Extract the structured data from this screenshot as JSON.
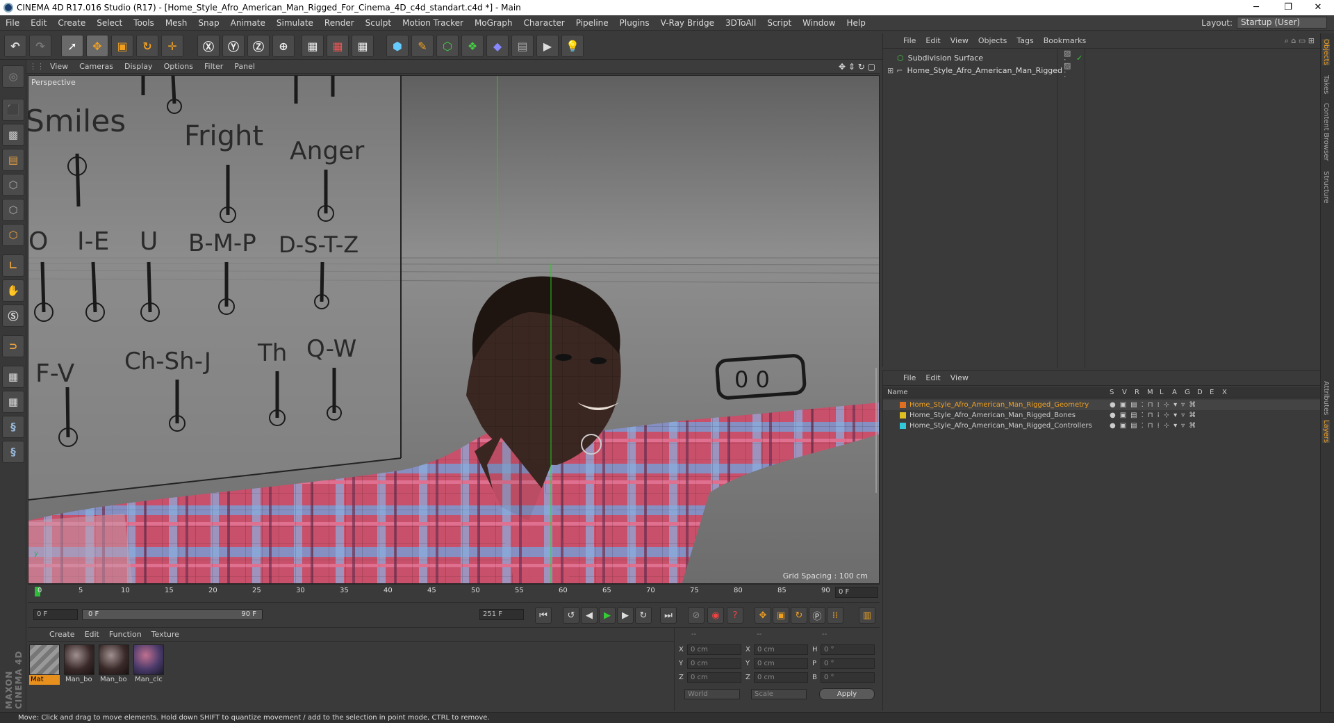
{
  "window": {
    "title": "CINEMA 4D R17.016 Studio (R17) - [Home_Style_Afro_American_Man_Rigged_For_Cinema_4D_c4d_standart.c4d *] - Main",
    "minimize": "─",
    "maximize": "❐",
    "close": "✕"
  },
  "menubar": {
    "items": [
      "File",
      "Edit",
      "Create",
      "Select",
      "Tools",
      "Mesh",
      "Snap",
      "Animate",
      "Simulate",
      "Render",
      "Sculpt",
      "Motion Tracker",
      "MoGraph",
      "Character",
      "Pipeline",
      "Plugins",
      "V-Ray Bridge",
      "3DToAll",
      "Script",
      "Window",
      "Help"
    ],
    "layout_label": "Layout:",
    "layout_value": "Startup (User)"
  },
  "viewport": {
    "menu": [
      "View",
      "Cameras",
      "Display",
      "Options",
      "Filter",
      "Panel"
    ],
    "label": "Perspective",
    "grid_spacing": "Grid Spacing : 100 cm",
    "board_labels": [
      "Smiles",
      "Fright",
      "Anger",
      "O",
      "I-E",
      "U",
      "B-M-P",
      "D-S-T-Z",
      "F-V",
      "Ch-Sh-J",
      "Th",
      "Q-W"
    ],
    "eye_control": "0    0"
  },
  "timeline": {
    "ticks": [
      "0",
      "5",
      "10",
      "15",
      "20",
      "25",
      "30",
      "35",
      "40",
      "45",
      "50",
      "55",
      "60",
      "65",
      "70",
      "75",
      "80",
      "85",
      "90"
    ],
    "current": "0 F"
  },
  "transport": {
    "start": "0 F",
    "range_start": "0 F",
    "range_end": "90 F",
    "end": "251 F"
  },
  "materials": {
    "menu": [
      "Create",
      "Edit",
      "Function",
      "Texture"
    ],
    "items": [
      "Mat",
      "Man_bo",
      "Man_bo",
      "Man_clc"
    ]
  },
  "coords": {
    "headers": [
      "--",
      "--",
      "--"
    ],
    "rows": [
      {
        "a": "X",
        "av": "0 cm",
        "b": "X",
        "bv": "0 cm",
        "c": "H",
        "cv": "0 °"
      },
      {
        "a": "Y",
        "av": "0 cm",
        "b": "Y",
        "bv": "0 cm",
        "c": "P",
        "cv": "0 °"
      },
      {
        "a": "Z",
        "av": "0 cm",
        "b": "Z",
        "bv": "0 cm",
        "c": "B",
        "cv": "0 °"
      }
    ],
    "world": "World",
    "scale": "Scale",
    "apply": "Apply"
  },
  "objects": {
    "menu": [
      "File",
      "Edit",
      "View",
      "Objects",
      "Tags",
      "Bookmarks"
    ],
    "items": [
      "Subdivision Surface",
      "Home_Style_Afro_American_Man_Rigged"
    ]
  },
  "layers": {
    "menu": [
      "File",
      "Edit",
      "View"
    ],
    "header": "Name",
    "cols": [
      "S",
      "V",
      "R",
      "M",
      "L",
      "A",
      "G",
      "D",
      "E",
      "X"
    ],
    "items": [
      {
        "name": "Home_Style_Afro_American_Man_Rigged_Geometry",
        "color": "#e07020"
      },
      {
        "name": "Home_Style_Afro_American_Man_Rigged_Bones",
        "color": "#e0c020"
      },
      {
        "name": "Home_Style_Afro_American_Man_Rigged_Controllers",
        "color": "#30c8d8"
      }
    ]
  },
  "right_tabs": [
    "Objects",
    "Takes",
    "Content Browser",
    "Structure",
    "Attributes",
    "Layers"
  ],
  "status": "Move: Click and drag to move elements. Hold down SHIFT to quantize movement / add to the selection in point mode, CTRL to remove.",
  "brand": "MAXON CINEMA 4D"
}
